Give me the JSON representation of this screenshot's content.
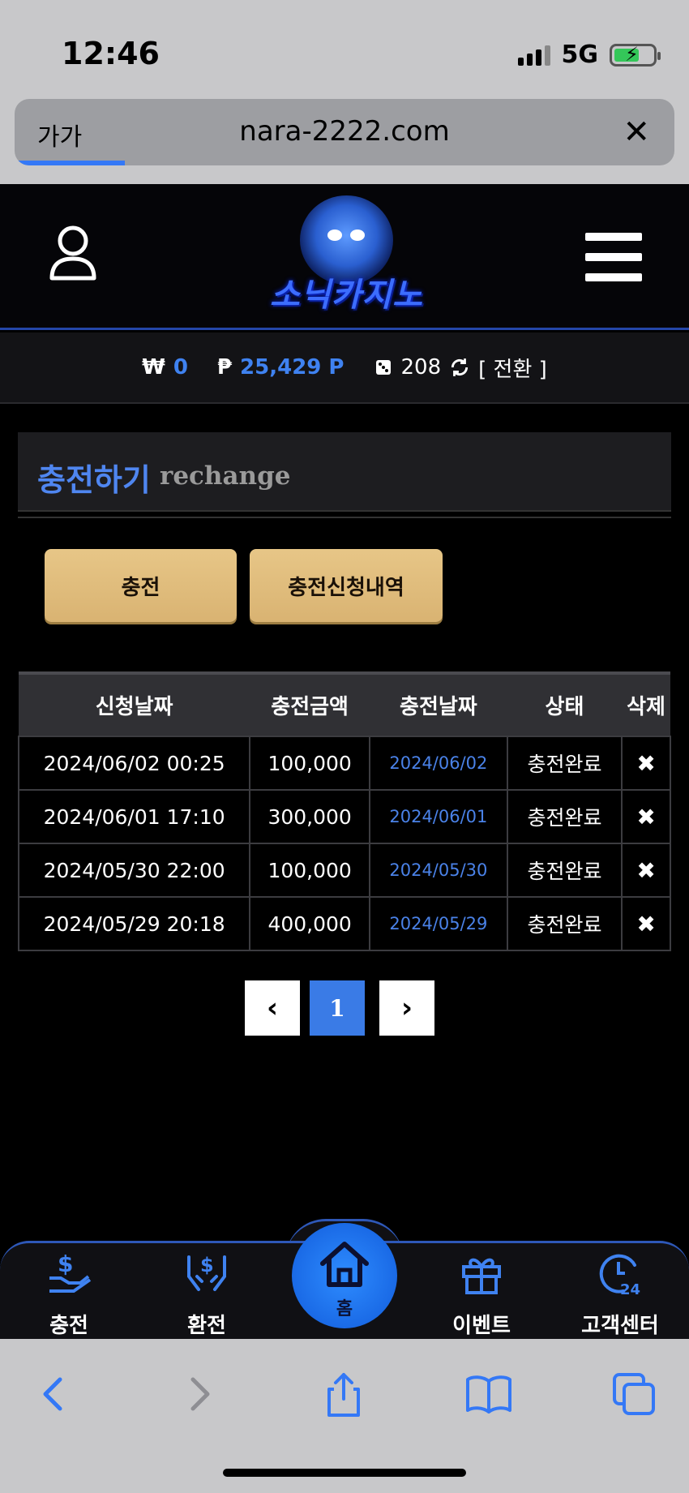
{
  "status_bar": {
    "time": "12:46",
    "network": "5G"
  },
  "browser": {
    "text_size_label": "가가",
    "url": "nara-2222.com",
    "close_glyph": "✕"
  },
  "header": {
    "logo_text": "소닉카지노"
  },
  "balance": {
    "won_symbol": "₩",
    "won_value": "0",
    "point_symbol": "₱",
    "point_value": "25,429 P",
    "chip_value": "208",
    "convert_label": "[ 전환 ]"
  },
  "section": {
    "title_ko": "충전하기",
    "title_en": "rechange"
  },
  "buttons": {
    "charge_label": "충전",
    "history_label": "충전신청내역"
  },
  "table": {
    "headers": [
      "신청날짜",
      "충전금액",
      "충전날짜",
      "상태",
      "삭제"
    ],
    "rows": [
      [
        "2024/06/02 00:25",
        "100,000",
        "2024/06/02",
        "충전완료",
        "✖"
      ],
      [
        "2024/06/01 17:10",
        "300,000",
        "2024/06/01",
        "충전완료",
        "✖"
      ],
      [
        "2024/05/30 22:00",
        "100,000",
        "2024/05/30",
        "충전완료",
        "✖"
      ],
      [
        "2024/05/29 20:18",
        "400,000",
        "2024/05/29",
        "충전완료",
        "✖"
      ]
    ]
  },
  "pagination": {
    "prev": "‹",
    "current": "1",
    "next": "›"
  },
  "bottom_nav": {
    "charge": "충전",
    "exchange": "환전",
    "home": "홈",
    "event": "이벤트",
    "cs": "고객센터"
  },
  "icons": {
    "user": "user-icon",
    "menu": "menu-icon",
    "charge": "hand-money-icon",
    "exchange": "hands-dollar-icon",
    "home": "home-icon",
    "event": "gift-icon",
    "cs": "24h-support-icon"
  },
  "colors": {
    "accent_blue": "#3f82f0",
    "button_gold": "#e2bf80",
    "background": "#000000"
  }
}
